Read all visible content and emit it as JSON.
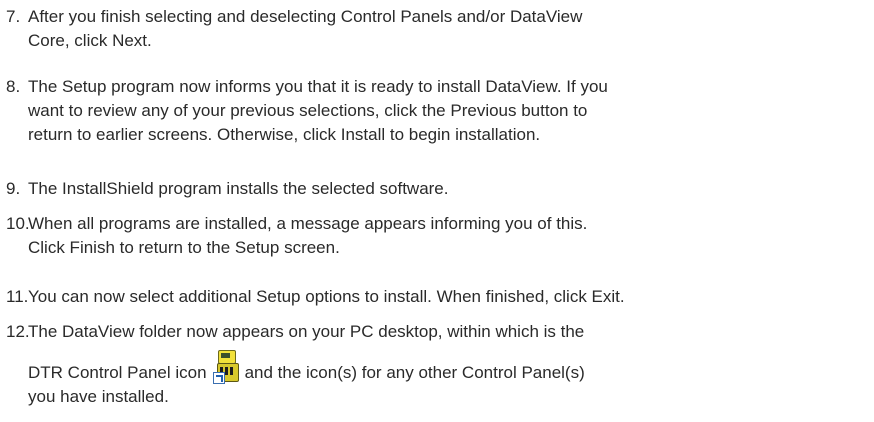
{
  "steps": [
    {
      "number": "7.",
      "lines": [
        "After you finish selecting and deselecting Control Panels and/or DataView",
        "Core, click Next."
      ]
    },
    {
      "number": "8.",
      "lines": [
        "The Setup program now informs you that it is ready to install DataView. If you",
        "want to review any of your previous selections, click the Previous button to",
        "return to earlier screens. Otherwise, click Install to begin installation."
      ]
    },
    {
      "number": "9.",
      "lines": [
        "The InstallShield program installs the selected software."
      ]
    },
    {
      "number": "10.",
      "lines": [
        "When all programs are installed, a message appears informing you of this.",
        "Click Finish to return to the Setup screen."
      ]
    },
    {
      "number": "11.",
      "lines": [
        "You can now select additional Setup options to install. When finished, click Exit."
      ]
    },
    {
      "number": "12.",
      "lines": [
        "The DataView folder now appears on your PC desktop, within which is the"
      ],
      "line2_before_icon": "DTR Control Panel icon",
      "line2_after_icon": "and the icon(s) for any other Control Panel(s)",
      "line3": "you have installed.",
      "icon": "dtr-control-panel-shortcut-icon"
    }
  ]
}
